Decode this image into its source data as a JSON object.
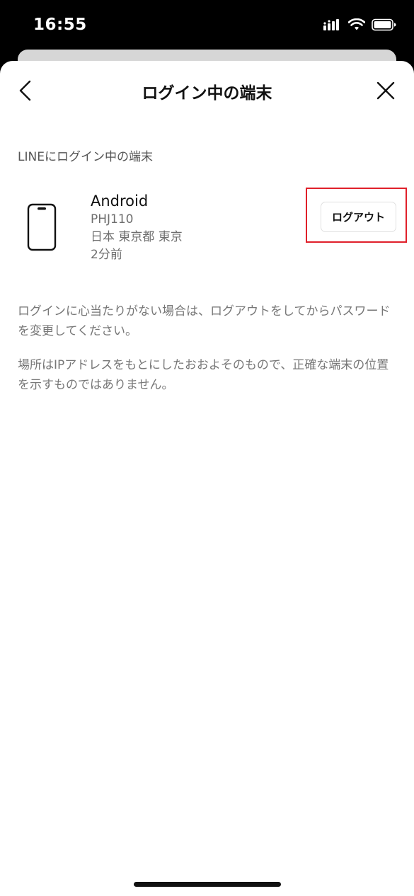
{
  "status_bar": {
    "time": "16:55"
  },
  "nav": {
    "title": "ログイン中の端末",
    "back_icon": "chevron-left-icon",
    "close_icon": "close-icon"
  },
  "section": {
    "label": "LINEにログイン中の端末"
  },
  "device": {
    "icon": "smartphone-icon",
    "name": "Android",
    "model": "PHJ110",
    "location": "日本 東京都 東京",
    "last_seen": "2分前",
    "logout_label": "ログアウト"
  },
  "notes": {
    "note_1": "ログインに心当たりがない場合は、ログアウトをしてからパスワードを変更してください。",
    "note_2": "場所はIPアドレスをもとにしたおおよそのもので、正確な端末の位置を示すものではありません。"
  },
  "colors": {
    "highlight": "#e0202a",
    "text_primary": "#111111",
    "text_secondary": "#777777"
  }
}
